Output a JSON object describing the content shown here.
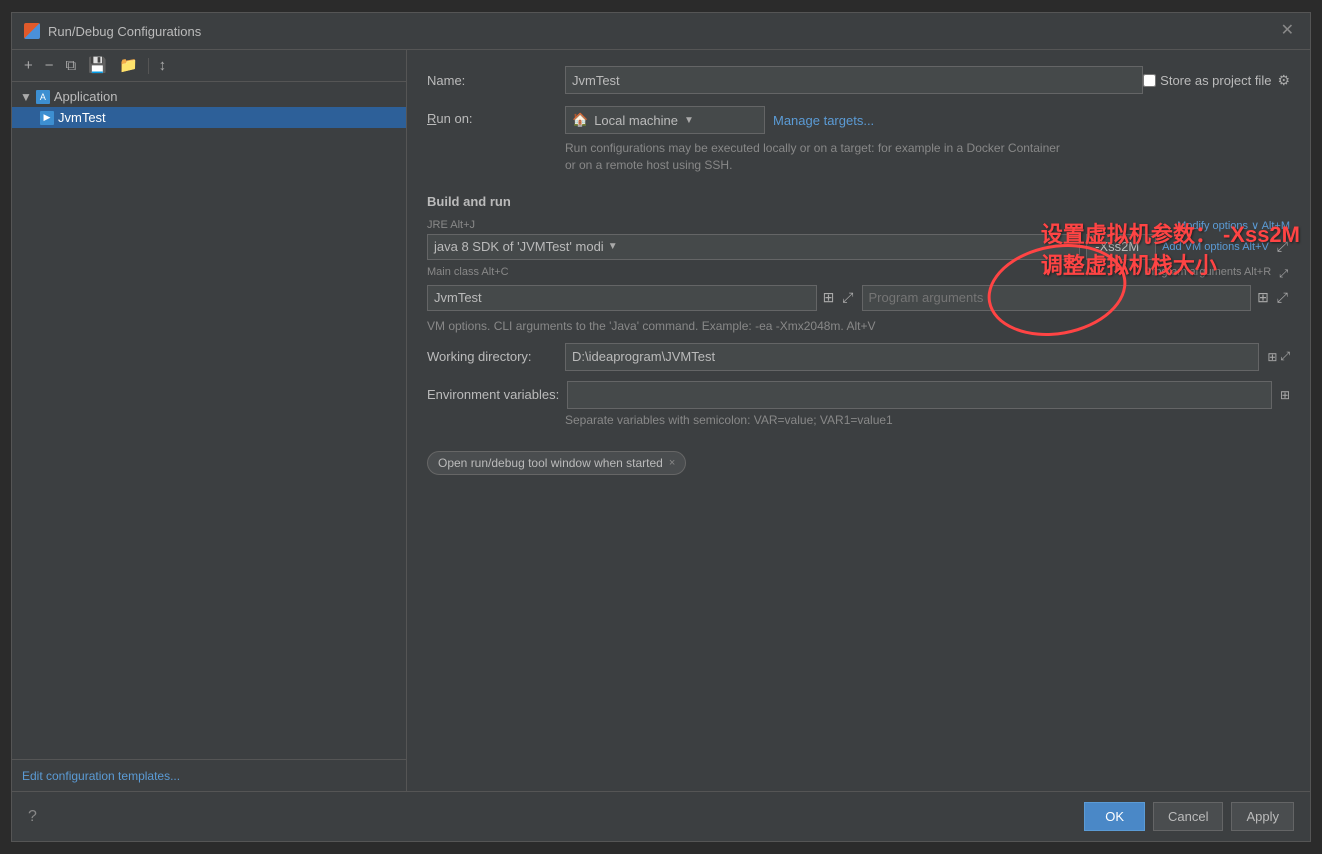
{
  "dialog": {
    "title": "Run/Debug Configurations",
    "close_label": "✕"
  },
  "toolbar": {
    "add_btn": "+",
    "remove_btn": "−",
    "copy_btn": "⧉",
    "save_btn": "💾",
    "folder_btn": "📁",
    "sort_btn": "↕"
  },
  "tree": {
    "group_label": "Application",
    "item_label": "JvmTest"
  },
  "footer_link": "Edit configuration templates...",
  "form": {
    "name_label": "Name:",
    "name_value": "JvmTest",
    "store_label": "Store as project file",
    "gear_icon": "⚙",
    "run_on_label": "Run on:",
    "local_machine": "Local machine",
    "manage_targets": "Manage targets...",
    "run_on_hint": "Run configurations may be executed locally or on a target: for example in a Docker Container or on a remote host using SSH.",
    "build_and_run": "Build and run",
    "jre_label": "JRE Alt+J",
    "sdk_value": "java 8  SDK of 'JVMTest' modi",
    "mod_options_label": "Modify options",
    "mod_options_shortcut": "Alt+M",
    "add_vm_label": "Add VM options",
    "add_vm_shortcut": "Alt+V",
    "vm_value": "-Xss2M",
    "main_class_label": "Main class Alt+C",
    "main_class_value": "JvmTest",
    "prog_args_label": "Program arguments",
    "prog_args_shortcut": "Alt+R",
    "prog_args_placeholder": "Program arguments",
    "vm_hint": "VM options. CLI arguments to the 'Java' command. Example: -ea -Xmx2048m. Alt+V",
    "working_dir_label": "Working directory:",
    "working_dir_value": "D:\\ideaprogram\\JVMTest",
    "env_vars_label": "Environment variables:",
    "env_vars_value": "",
    "env_hint": "Separate variables with semicolon: VAR=value; VAR1=value1",
    "chip_label": "Open run/debug tool window when started",
    "chip_close": "×"
  },
  "annotation": {
    "line1": "设置虚拟机参数：  -Xss2M",
    "line2": "调整虚拟机栈大小"
  },
  "bottom": {
    "help_icon": "?",
    "ok_label": "OK",
    "cancel_label": "Cancel",
    "apply_label": "Apply"
  }
}
